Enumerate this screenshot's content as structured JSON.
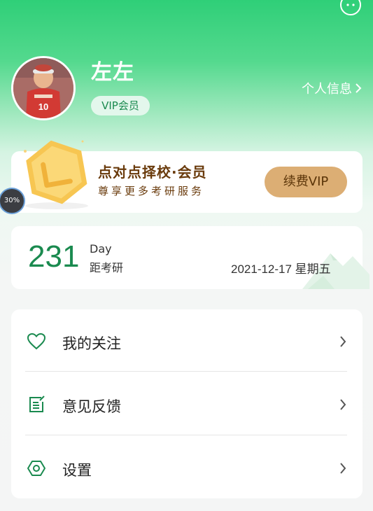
{
  "header": {
    "username": "左左",
    "vip_badge": "VIP会员",
    "profile_link": "个人信息"
  },
  "vip_card": {
    "title": "点对点择校·会员",
    "subtitle": "尊享更多考研服务",
    "button_label": "续费VIP"
  },
  "progress_badge": "30%",
  "countdown": {
    "days": "231",
    "unit": "Day",
    "label": "距考研",
    "exam_date": "2021-12-17 星期五"
  },
  "menu": [
    {
      "label": "我的关注",
      "icon": "heart-icon"
    },
    {
      "label": "意见反馈",
      "icon": "feedback-icon"
    },
    {
      "label": "设置",
      "icon": "settings-icon"
    }
  ],
  "colors": {
    "accent_green": "#1a8a4f",
    "header_green": "#2fcf78",
    "gold": "#dcae74",
    "vip_text": "#6a3b0c"
  }
}
